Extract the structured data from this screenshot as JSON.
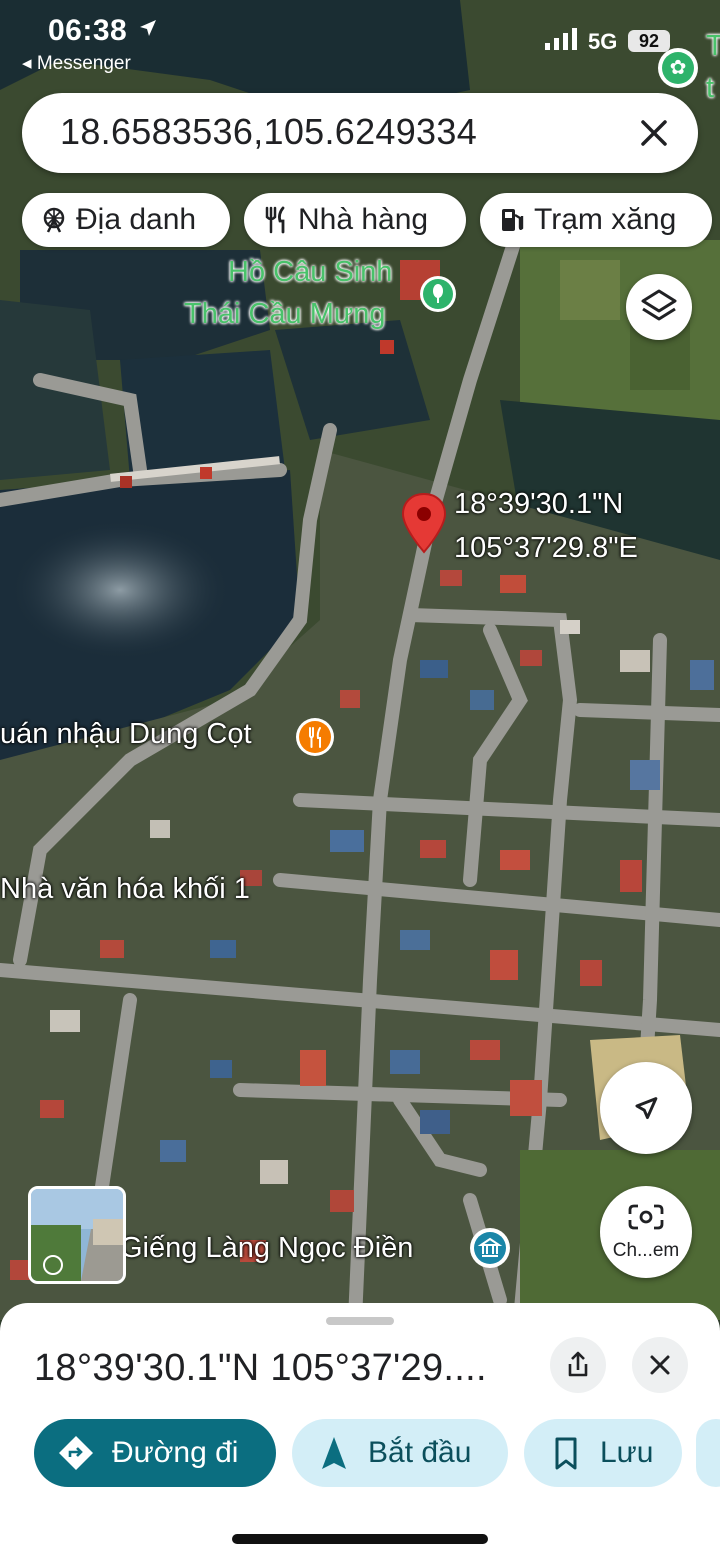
{
  "status_bar": {
    "time": "06:38",
    "back_app": "◂ Messenger",
    "network": "5G",
    "battery": "92"
  },
  "search": {
    "query": "18.6583536,105.6249334"
  },
  "chips": [
    {
      "label": "Địa danh",
      "icon": "ferris-wheel-icon"
    },
    {
      "label": "Nhà hàng",
      "icon": "fork-knife-icon"
    },
    {
      "label": "Trạm xăng",
      "icon": "gas-pump-icon"
    }
  ],
  "map": {
    "labels": {
      "lake_line1": "Hồ Câu Sinh",
      "lake_line2": "Thái Cầu Mưng",
      "restaurant": "uán nhậu Dung Cọt",
      "culture_house": "Nhà văn hóa khối 1",
      "well": "Giếng Làng Ngọc Điền",
      "corner_letter1": "T",
      "corner_letter2": "t"
    },
    "pin": {
      "lat": "18°39'30.1\"N",
      "lng": "105°37'29.8\"E"
    },
    "camera_label": "Ch...em"
  },
  "sheet": {
    "coords": "18°39'30.1\"N 105°37'29....",
    "buttons": {
      "directions": "Đường đi",
      "start": "Bắt đầu",
      "save": "Lưu"
    }
  },
  "colors": {
    "accent_teal": "#0b6e80",
    "chip_light": "#d3eef7",
    "pin_red": "#e53935"
  }
}
